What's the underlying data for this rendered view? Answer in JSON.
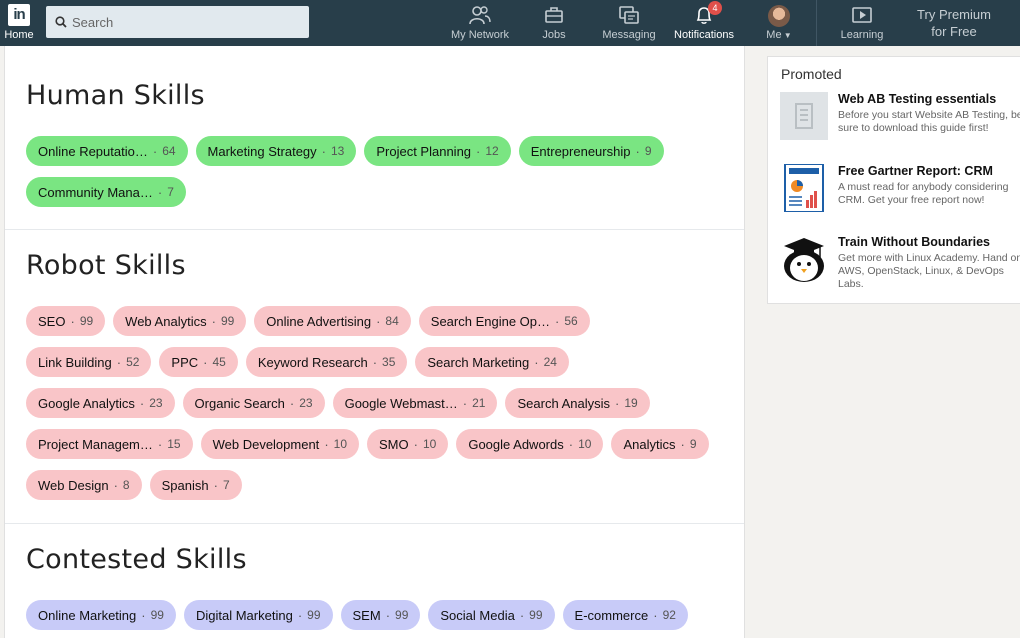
{
  "nav": {
    "home_label": "Home",
    "logo_text": "in",
    "search_placeholder": "Search",
    "items": [
      {
        "label": "My Network",
        "icon": "network-icon"
      },
      {
        "label": "Jobs",
        "icon": "briefcase-icon"
      },
      {
        "label": "Messaging",
        "icon": "chat-icon"
      },
      {
        "label": "Notifications",
        "icon": "bell-icon",
        "badge": "4"
      },
      {
        "label": "Me",
        "icon": "avatar"
      },
      {
        "label": "Learning",
        "icon": "learning-icon"
      }
    ],
    "premium_line1": "Try Premium",
    "premium_line2": "for Free"
  },
  "sections": {
    "human": {
      "title": "Human Skills",
      "color": "#7ae582",
      "chips": [
        {
          "name": "Online Reputatio…",
          "count": "64"
        },
        {
          "name": "Marketing Strategy",
          "count": "13"
        },
        {
          "name": "Project Planning",
          "count": "12"
        },
        {
          "name": "Entrepreneurship",
          "count": "9"
        },
        {
          "name": "Community Mana…",
          "count": "7"
        }
      ]
    },
    "robot": {
      "title": "Robot Skills",
      "color": "#f9c5c8",
      "chips": [
        {
          "name": "SEO",
          "count": "99"
        },
        {
          "name": "Web Analytics",
          "count": "99"
        },
        {
          "name": "Online Advertising",
          "count": "84"
        },
        {
          "name": "Search Engine Op…",
          "count": "56"
        },
        {
          "name": "Link Building",
          "count": "52"
        },
        {
          "name": "PPC",
          "count": "45"
        },
        {
          "name": "Keyword Research",
          "count": "35"
        },
        {
          "name": "Search Marketing",
          "count": "24"
        },
        {
          "name": "Google Analytics",
          "count": "23"
        },
        {
          "name": "Organic Search",
          "count": "23"
        },
        {
          "name": "Google Webmast…",
          "count": "21"
        },
        {
          "name": "Search Analysis",
          "count": "19"
        },
        {
          "name": "Project Managem…",
          "count": "15"
        },
        {
          "name": "Web Development",
          "count": "10"
        },
        {
          "name": "SMO",
          "count": "10"
        },
        {
          "name": "Google Adwords",
          "count": "10"
        },
        {
          "name": "Analytics",
          "count": "9"
        },
        {
          "name": "Web Design",
          "count": "8"
        },
        {
          "name": "Spanish",
          "count": "7"
        }
      ]
    },
    "contested": {
      "title": "Contested Skills",
      "color": "#c8cbf8",
      "chips": [
        {
          "name": "Online Marketing",
          "count": "99"
        },
        {
          "name": "Digital Marketing",
          "count": "99"
        },
        {
          "name": "SEM",
          "count": "99"
        },
        {
          "name": "Social Media",
          "count": "99"
        },
        {
          "name": "E-commerce",
          "count": "92"
        }
      ]
    }
  },
  "promoted": {
    "title": "Promoted",
    "ads": [
      {
        "title": "Web AB Testing essentials",
        "desc": "Before you start Website AB Testing, be sure to download this guide first!",
        "icon": "document-icon"
      },
      {
        "title": "Free Gartner Report: CRM",
        "desc": "A must read for anybody considering CRM. Get your free report now!",
        "icon": "report-icon"
      },
      {
        "title": "Train Without Boundaries",
        "desc": "Get more with Linux Academy. Hand on AWS, OpenStack, Linux, & DevOps Labs.",
        "icon": "penguin-graduate-icon"
      }
    ]
  }
}
